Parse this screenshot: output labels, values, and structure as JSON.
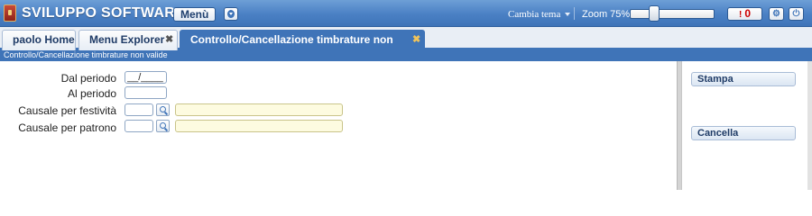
{
  "header": {
    "app_title": "SVILUPPO SOFTWARE",
    "menu_label": "Menù",
    "theme_label": "Cambia tema",
    "zoom_label": "Zoom 75%",
    "zoom_value": 75,
    "notifications_icon": "!",
    "notifications_count": "0"
  },
  "tabs": [
    {
      "label": "paolo Home",
      "closable": false
    },
    {
      "label": "Menu Explorer",
      "closable": true
    },
    {
      "label": "Controllo/Cancellazione timbrature non valide",
      "closable": true,
      "active": true
    }
  ],
  "breadcrumb": "Controllo/Cancellazione timbrature non valide",
  "form": {
    "dal_periodo": {
      "label": "Dal periodo",
      "value": "__/____"
    },
    "al_periodo": {
      "label": "Al periodo",
      "value": ""
    },
    "causale_festivita": {
      "label": "Causale per festività",
      "code": "",
      "description": ""
    },
    "causale_patrono": {
      "label": "Causale per patrono",
      "code": "",
      "description": ""
    }
  },
  "actions": {
    "stampa": "Stampa",
    "cancella": "Cancella"
  },
  "colors": {
    "header_blue": "#4a80c4",
    "active_tab": "#3f74b8",
    "description_field": "#fdfbe0",
    "badge_red": "#cc0000"
  }
}
